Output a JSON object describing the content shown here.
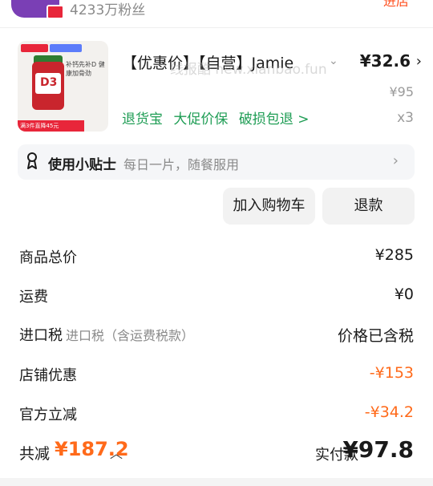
{
  "shop": {
    "fans": "4233万粉丝",
    "action": "进店"
  },
  "product": {
    "title": "【优惠价】【自营】Jamie",
    "watermark": "线报酷 new.xianbao.fun",
    "thumb_text": "补钙先补D 健康加骨劲",
    "thumb_promo": "满3件直降45元",
    "thumb_badge": "D3",
    "price": "¥32.6",
    "original_price": "¥95",
    "quantity": "x3",
    "services": [
      "退货宝",
      "大促价保",
      "破损包退 >"
    ]
  },
  "tip": {
    "title": "使用小贴士",
    "text": "每日一片，随餐服用"
  },
  "buttons": {
    "cart": "加入购物车",
    "refund": "退款"
  },
  "summary": [
    {
      "label": "商品总价",
      "sub": "",
      "value": "¥285",
      "negative": false
    },
    {
      "label": "运费",
      "sub": "",
      "value": "¥0",
      "negative": false
    },
    {
      "label": "进口税",
      "sub": "进口税（含运费税款）",
      "value": "价格已含税",
      "negative": false
    },
    {
      "label": "店铺优惠",
      "sub": "",
      "value": "-¥153",
      "negative": true
    },
    {
      "label": "官方立减",
      "sub": "",
      "value": "-¥34.2",
      "negative": true
    }
  ],
  "footer": {
    "total_discount_label": "共减",
    "total_discount": "¥187.2",
    "paid_label": "实付款",
    "paid": "¥97.8"
  },
  "colors": {
    "accent": "#ff6a1a",
    "service_green": "#1f9d55"
  }
}
